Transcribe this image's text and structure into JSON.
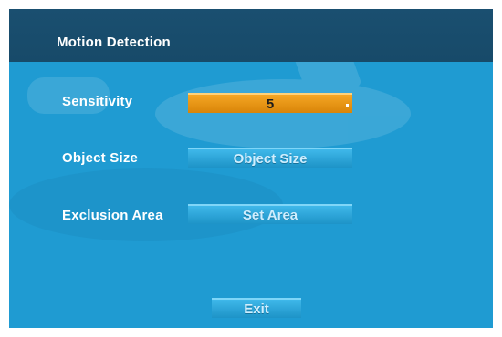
{
  "window": {
    "title": "Motion Detection"
  },
  "rows": [
    {
      "label": "Sensitivity",
      "control": "5"
    },
    {
      "label": "Object Size",
      "control": "Object Size"
    },
    {
      "label": "Exclusion Area",
      "control": "Set Area"
    }
  ],
  "exit": {
    "label": "Exit"
  },
  "colors": {
    "title_bar": "#174a69",
    "panel_bg": "#1f9bd2",
    "selected_control": "#e8940f",
    "button": "#2aa7dc"
  }
}
